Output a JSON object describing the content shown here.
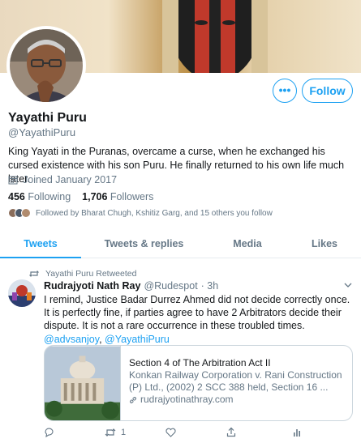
{
  "profile": {
    "name": "Yayathi Puru",
    "handle": "@YayathiPuru",
    "bio": "King Yayati in the Puranas, overcame a curse, when he exchanged his cursed existence  with his son Puru. He finally returned to his own life much later.",
    "joined": "Joined January 2017",
    "following_count": "456",
    "following_label": "Following",
    "followers_count": "1,706",
    "followers_label": "Followers",
    "followed_by": "Followed by Bharat Chugh, Kshitiz Garg, and 15 others you follow",
    "follow_label": "Follow",
    "more_label": "•••"
  },
  "tabs": [
    {
      "label": "Tweets",
      "active": true
    },
    {
      "label": "Tweets & replies",
      "active": false
    },
    {
      "label": "Media",
      "active": false
    },
    {
      "label": "Likes",
      "active": false
    }
  ],
  "tweet": {
    "retweet_label": "Yayathi Puru Retweeted",
    "author_name": "Rudrajyoti Nath Ray",
    "author_handle": "@Rudespot",
    "time": "· 3h",
    "text_before": "I remind, Justice Badar Durrez Ahmed did not decide correctly once. It is perfectly fine, if parties agree to have 2 Arbitrators decide their dispute. It is not a rare occurrence in these troubled times. ",
    "mention1": "@advsanjoy",
    "mention_sep": ", ",
    "mention2": "@YayathiPuru",
    "card": {
      "title": "Section 4 of The Arbitration Act II",
      "description": "Konkan Railway Corporation v. Rani Construction (P) Ltd., (2002) 2 SCC 388 held, Section 16 ...",
      "url": "rudrajyotinathray.com"
    },
    "retweet_count": "1"
  },
  "colors": {
    "accent": "#1da1f2",
    "secondary_text": "#657786",
    "border": "#e6ecf0"
  }
}
